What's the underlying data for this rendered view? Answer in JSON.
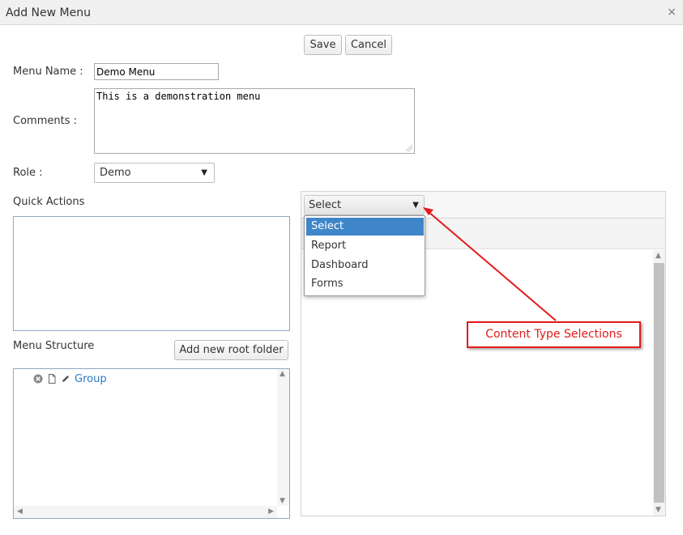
{
  "dialog": {
    "title": "Add New Menu",
    "close_glyph": "×"
  },
  "toolbar": {
    "save_label": "Save",
    "cancel_label": "Cancel"
  },
  "form": {
    "menu_name_label": "Menu Name :",
    "menu_name_value": "Demo Menu",
    "comments_label": "Comments :",
    "comments_value": "This is a demonstration menu",
    "role_label": "Role :",
    "role_value": "Demo"
  },
  "quick_actions": {
    "label": "Quick Actions"
  },
  "menu_structure": {
    "label": "Menu Structure",
    "add_root_label": "Add new root folder",
    "tree": [
      {
        "label": "Group",
        "icons": [
          "remove-icon",
          "document-icon",
          "edit-icon"
        ]
      }
    ]
  },
  "content_type": {
    "selected": "Select",
    "options": [
      "Select",
      "Report",
      "Dashboard",
      "Forms"
    ],
    "highlighted_index": 0
  },
  "annotation": {
    "text": "Content Type Selections",
    "color": "#e11b1b"
  },
  "colors": {
    "accent": "#3f86c9",
    "link": "#2a78c1",
    "panel_border": "#8fa8c4"
  }
}
